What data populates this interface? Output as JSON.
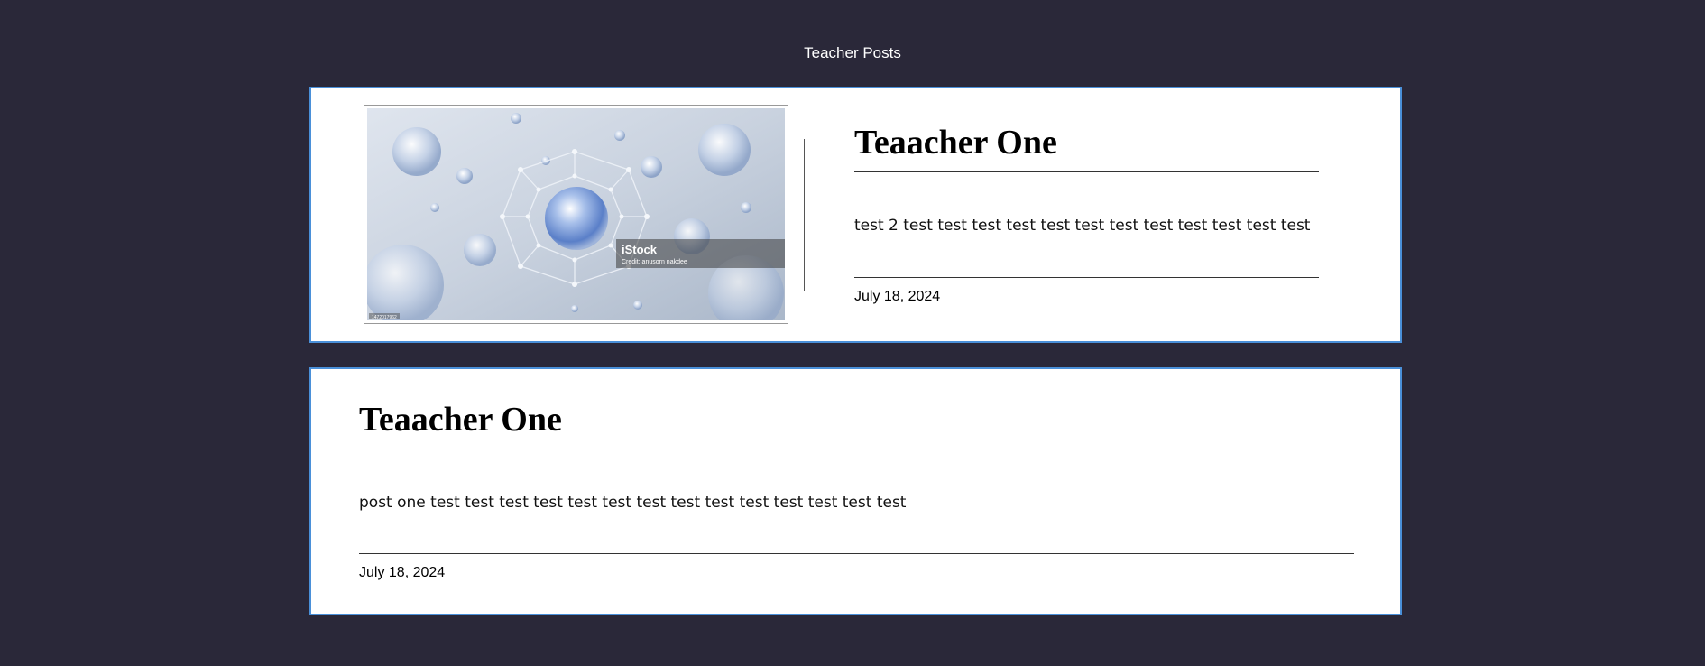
{
  "page": {
    "title": "Teacher Posts"
  },
  "posts": [
    {
      "heading": "Teaacher One",
      "text": "test 2 test test test test test test test test test test test test",
      "date": "July 18, 2024",
      "image": {
        "watermark_brand": "iStock",
        "watermark_credit": "Credit: anusorn nakdee",
        "corner_mark": "1472017962"
      }
    },
    {
      "heading": "Teaacher One",
      "text": "post one test test test test test test test test test test test test test test",
      "date": "July 18, 2024"
    }
  ],
  "colors": {
    "background": "#2a2839",
    "card_border": "#4a90d9",
    "card_background": "#ffffff"
  }
}
